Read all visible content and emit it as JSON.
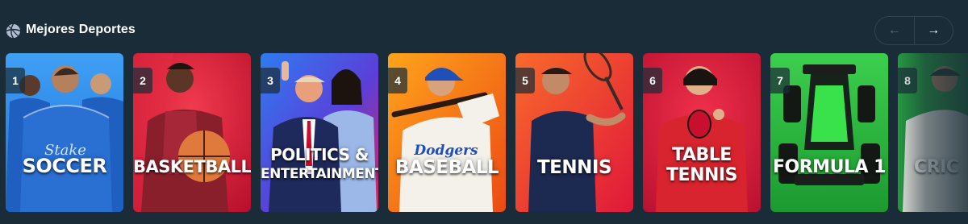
{
  "section": {
    "title": "Mejores Deportes",
    "icon": "sports-ball-icon"
  },
  "nav": {
    "prev_icon": "←",
    "next_icon": "→"
  },
  "cards": [
    {
      "rank": "1",
      "title": "SOCCER",
      "jersey_text": "Stake"
    },
    {
      "rank": "2",
      "title": "BASKETBALL"
    },
    {
      "rank": "3",
      "title_line1": "POLITICS &",
      "title_line2": "ENTERTAINMENT"
    },
    {
      "rank": "4",
      "title": "BASEBALL",
      "jersey_text": "Dodgers"
    },
    {
      "rank": "5",
      "title": "TENNIS"
    },
    {
      "rank": "6",
      "title_line1": "TABLE",
      "title_line2": "TENNIS"
    },
    {
      "rank": "7",
      "title": "FORMULA 1"
    },
    {
      "rank": "8",
      "title": "CRIC"
    }
  ],
  "colors": {
    "background": "#1a2c38",
    "soccer": "#2b8ae8",
    "basketball": "#d8203c",
    "politics": "#3a4fd8",
    "baseball": "#f26a12",
    "tennis": "#f04e1c",
    "table_tennis": "#e3183a",
    "formula1": "#2bb53d",
    "cricket": "#1f8a3a"
  }
}
